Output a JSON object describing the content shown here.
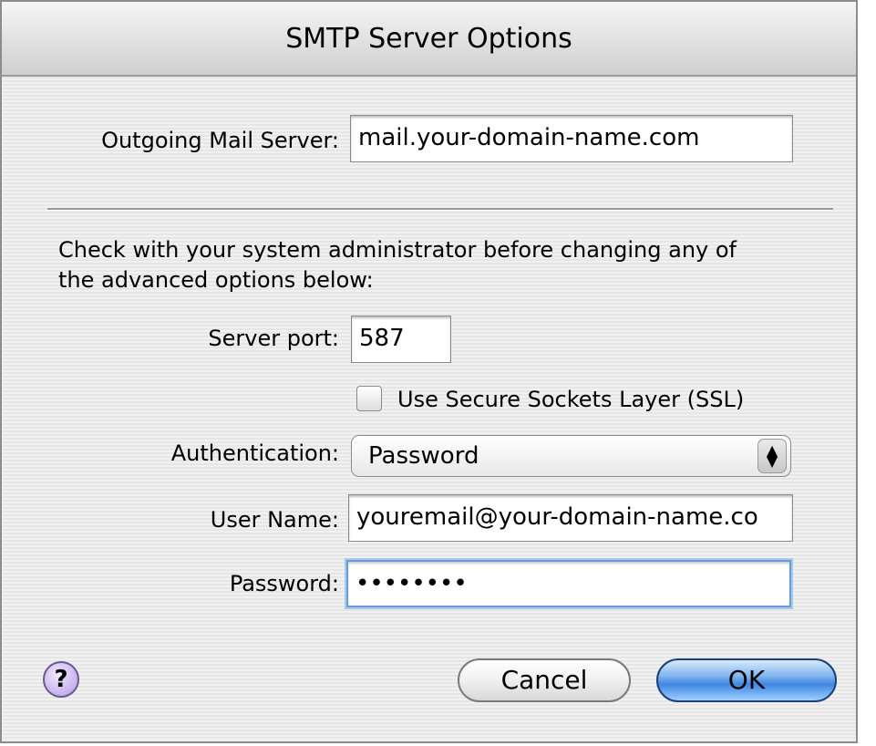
{
  "window": {
    "title": "SMTP Server Options"
  },
  "outgoing_mail_server": {
    "label": "Outgoing Mail Server:",
    "value": "mail.your-domain-name.com"
  },
  "advisory_text": {
    "line1": "Check with your system administrator before changing any of",
    "line2": "the advanced options below:"
  },
  "server_port": {
    "label": "Server port:",
    "value": "587"
  },
  "ssl_checkbox": {
    "label": "Use Secure Sockets Layer (SSL)",
    "checked": false
  },
  "authentication": {
    "label": "Authentication:",
    "selected": "Password",
    "arrows": "▲▼"
  },
  "user_name": {
    "label": "User Name:",
    "value": "youremail@your-domain-name.co"
  },
  "password": {
    "label": "Password:",
    "value": "••••••••"
  },
  "buttons": {
    "help": "?",
    "cancel": "Cancel",
    "ok": "OK"
  }
}
